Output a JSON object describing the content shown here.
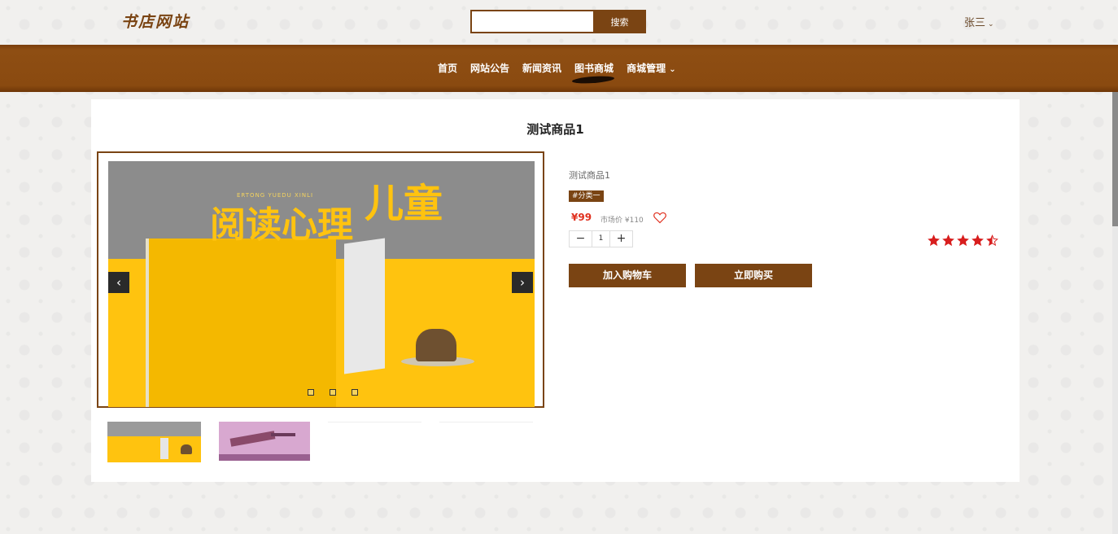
{
  "header": {
    "logo": "书店网站",
    "search": {
      "placeholder": "",
      "button_label": "搜索"
    },
    "user": {
      "name": "张三"
    }
  },
  "nav": {
    "items": [
      {
        "label": "首页"
      },
      {
        "label": "网站公告"
      },
      {
        "label": "新闻资讯"
      },
      {
        "label": "图书商城",
        "active": true
      },
      {
        "label": "商城管理",
        "has_dropdown": true
      }
    ]
  },
  "product": {
    "title": "测试商品1",
    "name": "测试商品1",
    "tag": "#分类一",
    "price": "¥99",
    "market_price": "市场价 ¥110",
    "quantity": "1",
    "rating": 4.5,
    "add_to_cart_label": "加入购物车",
    "buy_now_label": "立即购买"
  },
  "gallery": {
    "cover_title_top": "儿童",
    "cover_title_bottom": "阅读心理",
    "cover_pinyin": "ERTONG YUEDU XINLI",
    "thumbnail_count": 4,
    "active_slide": 1
  },
  "colors": {
    "brand": "#7a4413",
    "price": "#e0301e",
    "star": "#d81e1e"
  },
  "icons": {
    "prev": "chevron-left-icon",
    "next": "chevron-right-icon",
    "favorite": "heart-outline-icon",
    "user_menu": "chevron-down-icon"
  }
}
